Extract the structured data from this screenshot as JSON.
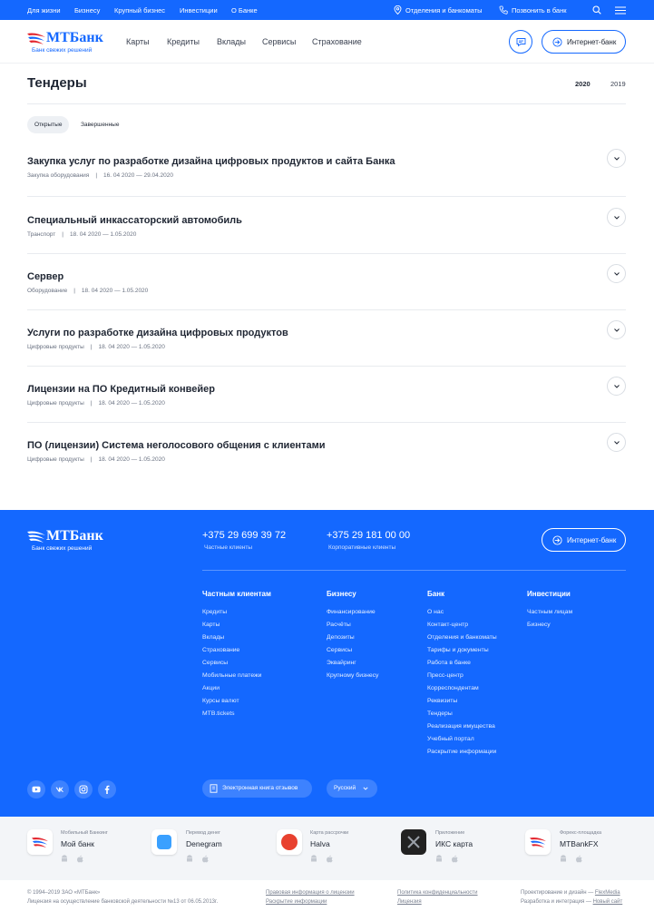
{
  "topbar": {
    "links": [
      "Для жизни",
      "Бизнесу",
      "Крупный бизнес",
      "Инвестиции",
      "О Банке"
    ],
    "branches": "Отделения и банкоматы",
    "call": "Позвонить в банк"
  },
  "header": {
    "logo_name": "МТБанк",
    "logo_tagline": "Банк свежих решений",
    "nav": [
      "Карты",
      "Кредиты",
      "Вклады",
      "Сервисы",
      "Страхование"
    ],
    "internet_bank": "Интернет-банк"
  },
  "page": {
    "title": "Тендеры",
    "years": [
      "2020",
      "2019"
    ],
    "tabs": [
      "Открытые",
      "Завершенные"
    ]
  },
  "tenders": [
    {
      "title": "Закупка услуг по разработке дизайна цифровых продуктов и сайта Банка",
      "category": "Закупка оборудования",
      "dates": "16. 04 2020 — 29.04.2020"
    },
    {
      "title": "Специальный инкассаторский автомобиль",
      "category": "Транспорт",
      "dates": "18. 04 2020 — 1.05.2020"
    },
    {
      "title": "Сервер",
      "category": "Оборудование",
      "dates": "18. 04 2020 — 1.05.2020"
    },
    {
      "title": "Услуги по разработке дизайна цифровых продуктов",
      "category": "Цифровые продукты",
      "dates": "18. 04 2020 — 1.05.2020"
    },
    {
      "title": "Лицензии на ПО Кредитный конвейер",
      "category": "Цифровые продукты",
      "dates": "18. 04 2020 — 1.05.2020"
    },
    {
      "title": "ПО (лицензии) Система неголосового общения с клиентами",
      "category": "Цифровые продукты",
      "dates": "18. 04 2020 — 1.05.2020"
    }
  ],
  "footer": {
    "logo_name": "МТБанк",
    "logo_tagline": "Банк свежих решений",
    "phone1": "+375 29 699 39 72",
    "phone1_label": "Частные клиенты",
    "phone2": "+375 29 181 00 00",
    "phone2_label": "Корпоративные клиенты",
    "internet_bank": "Интернет-банк",
    "columns": [
      {
        "title": "Частным клиентам",
        "items": [
          "Кредиты",
          "Карты",
          "Вклады",
          "Страхование",
          "Сервисы",
          "Мобильные платежи",
          "Акции",
          "Курсы валют",
          "MTB.tickets"
        ]
      },
      {
        "title": "Бизнесу",
        "items": [
          "Финансирование",
          "Расчёты",
          "Депозиты",
          "Сервисы",
          "Эквайринг",
          "Крупному бизнесу"
        ]
      },
      {
        "title": "Банк",
        "items": [
          "О нас",
          "Контакт-центр",
          "Отделения и банкоматы",
          "Тарифы и документы",
          "Работа в банке",
          "Пресс-центр",
          "Корреспондентам",
          "Реквизиты",
          "Тендеры",
          "Реализация имущества",
          "Учебный портал",
          "Раскрытие информации"
        ]
      },
      {
        "title": "Инвестиции",
        "items": [
          "Частным лицам",
          "Бизнесу"
        ]
      }
    ],
    "feedback": "Электронная книга отзывов",
    "language": "Русский"
  },
  "apps": [
    {
      "caption": "Мобильный Банкинг",
      "name": "Мой банк",
      "color": "#ffffff"
    },
    {
      "caption": "Перевод денег",
      "name": "Denegram",
      "color": "#ffffff"
    },
    {
      "caption": "Карта рассрочки",
      "name": "Halva",
      "color": "#ffffff"
    },
    {
      "caption": "Приложение",
      "name": "ИКС карта",
      "color": "#222222"
    },
    {
      "caption": "Форекс-площадка",
      "name": "MTBankFX",
      "color": "#ffffff"
    }
  ],
  "bottom": {
    "copyright": "© 1994–2019 ЗАО «МТБанк»",
    "license": "Лицензия на осуществление банковской деятельности №13 от 06.05.2013г.",
    "l1": "Правовая информация о лицензии",
    "l2": "Раскрытие информации",
    "l3": "Политика конфиденциальности",
    "l4": "Лицензия",
    "design": "Проектирование и дизайн —",
    "design_link": "FlexMedia",
    "dev": "Разработка и интеграция —",
    "dev_link": "Новый сайт"
  },
  "colors": {
    "brand": "#1468ff",
    "accent_red": "#e3262f"
  }
}
